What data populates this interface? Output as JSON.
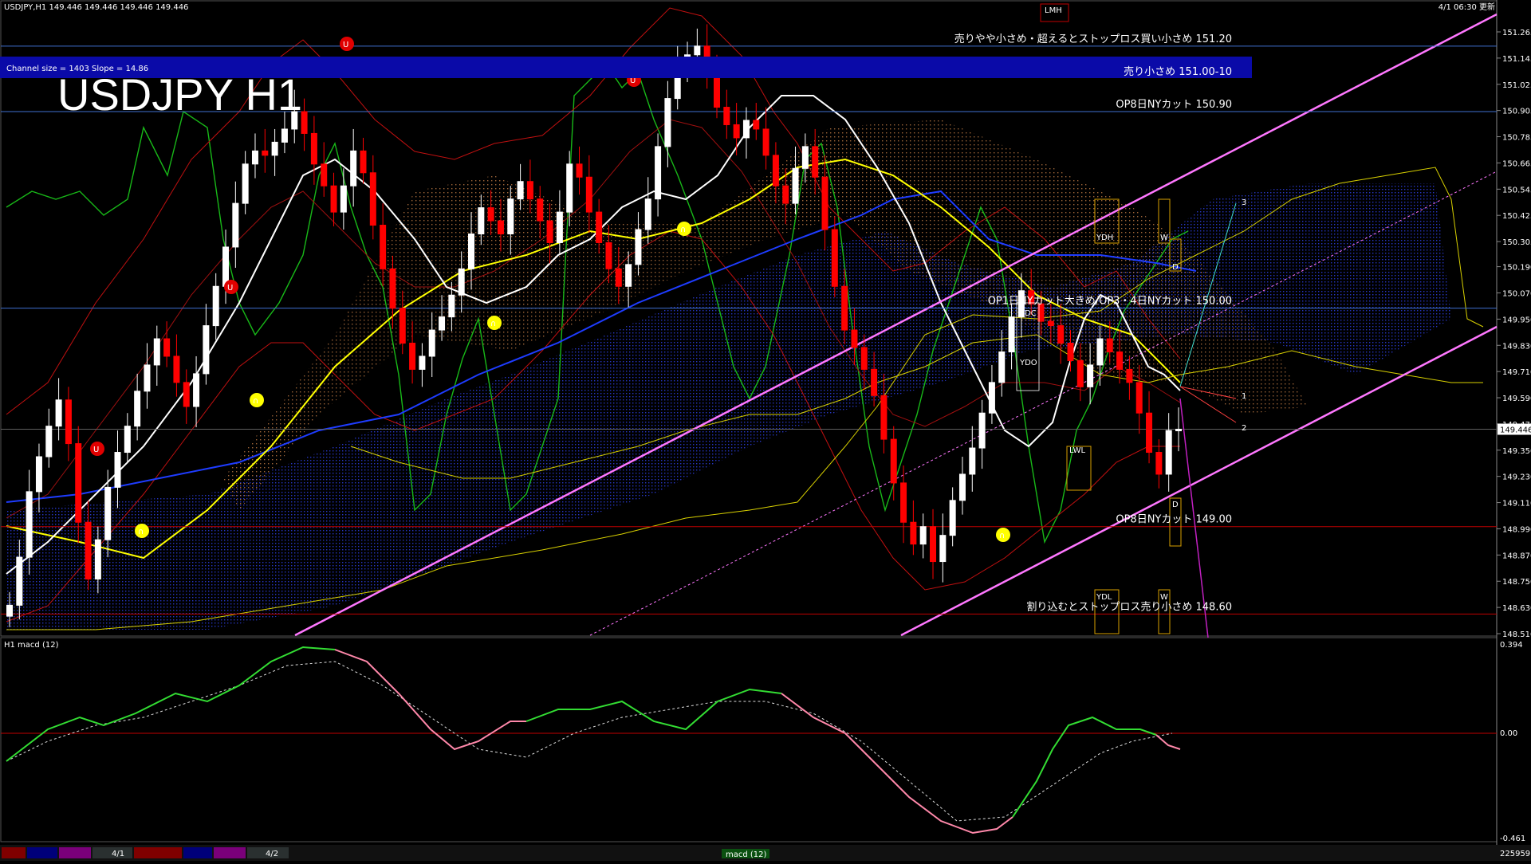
{
  "header": {
    "symbol_line": "USDJPY,H1  149.446 149.446 149.446 149.446",
    "updated": "4/1 06:30 更新",
    "channel_info": "Channel size = 1403 Slope = 14.86",
    "big_title": "USDJPY H1"
  },
  "price_axis": {
    "ticks": [
      "151.265",
      "151.145",
      "151.025",
      "150.905",
      "150.785",
      "150.665",
      "150.545",
      "150.425",
      "150.305",
      "150.190",
      "150.070",
      "149.950",
      "149.830",
      "149.710",
      "149.590",
      "149.470",
      "149.350",
      "149.230",
      "149.110",
      "148.990",
      "148.870",
      "148.750",
      "148.630",
      "148.510"
    ],
    "current_price": "149.446"
  },
  "annotations": [
    {
      "text": "売りやや小さめ・超えるとストップロス買い小さめ 151.20",
      "price": 151.2
    },
    {
      "text": "売り小さめ 151.00-10",
      "price": 151.05
    },
    {
      "text": "OP8日NYカット 150.90",
      "price": 150.9
    },
    {
      "text": "OP1日NYカット大きめ/OP3・4日NYカット 150.00",
      "price": 150.0
    },
    {
      "text": "OP8日NYカット 149.00",
      "price": 149.0
    },
    {
      "text": "割り込むとストップロス売り小さめ 148.60",
      "price": 148.6
    }
  ],
  "box_labels": {
    "ydh": "YDH",
    "ydc": "YDC",
    "ydo": "YDO",
    "ydl": "YDL",
    "lwl": "LWL",
    "lwh": "LMH",
    "w": "W",
    "d": "D"
  },
  "projection_labels": [
    "1",
    "2",
    "3"
  ],
  "macd": {
    "label": "H1  macd (12)",
    "scale_top": "0.394",
    "scale_zero": "0.00",
    "scale_bottom": "-0.461"
  },
  "bottom_bar": {
    "date1": "4/1",
    "date2": "4/2",
    "indicator": "macd (12)",
    "counter": "225959"
  },
  "colors": {
    "bull": "#ffffff",
    "bear": "#ff0000",
    "ma_fast": "#ffffff",
    "ma_slow": "#ffff00",
    "ma_blue": "#1e3cff",
    "bollinger": "#d01010",
    "chikou": "#18b818",
    "channel": "#ff77ff",
    "cloud_blue": "#1a2aa0",
    "cloud_orange": "#d08040",
    "kijun": "#d8d000",
    "macd_up": "#33dd33",
    "macd_down": "#ff88aa",
    "signal": "#dddddd",
    "level_blue": "#3f6fd0",
    "level_red": "#c00000"
  },
  "chart_data": {
    "type": "candlestick",
    "symbol": "USDJPY",
    "timeframe": "H1",
    "ylim": [
      148.51,
      151.265
    ],
    "current_price": 149.446,
    "closes": [
      148.64,
      148.86,
      149.16,
      149.32,
      149.46,
      149.58,
      149.38,
      149.02,
      148.76,
      148.94,
      149.18,
      149.34,
      149.46,
      149.62,
      149.74,
      149.86,
      149.78,
      149.66,
      149.55,
      149.7,
      149.92,
      150.1,
      150.28,
      150.48,
      150.66,
      150.72,
      150.7,
      150.76,
      150.82,
      150.9,
      150.8,
      150.66,
      150.56,
      150.44,
      150.56,
      150.72,
      150.62,
      150.38,
      150.18,
      150.0,
      149.84,
      149.72,
      149.78,
      149.9,
      149.96,
      150.06,
      150.18,
      150.34,
      150.46,
      150.4,
      150.34,
      150.5,
      150.58,
      150.5,
      150.4,
      150.3,
      150.44,
      150.66,
      150.6,
      150.44,
      150.3,
      150.18,
      150.1,
      150.2,
      150.36,
      150.5,
      150.74,
      150.96,
      151.1,
      151.16,
      151.2,
      151.1,
      150.92,
      150.84,
      150.78,
      150.86,
      150.82,
      150.7,
      150.56,
      150.48,
      150.64,
      150.74,
      150.6,
      150.36,
      150.1,
      149.9,
      149.82,
      149.72,
      149.6,
      149.4,
      149.2,
      149.02,
      148.92,
      149.0,
      148.84,
      148.96,
      149.12,
      149.24,
      149.36,
      149.52,
      149.66,
      149.8,
      149.96,
      150.08,
      150.02,
      149.94,
      149.92,
      149.84,
      149.76,
      149.64,
      149.74,
      149.86,
      149.8,
      149.72,
      149.66,
      149.52,
      149.34,
      149.24,
      149.44,
      149.446
    ]
  }
}
